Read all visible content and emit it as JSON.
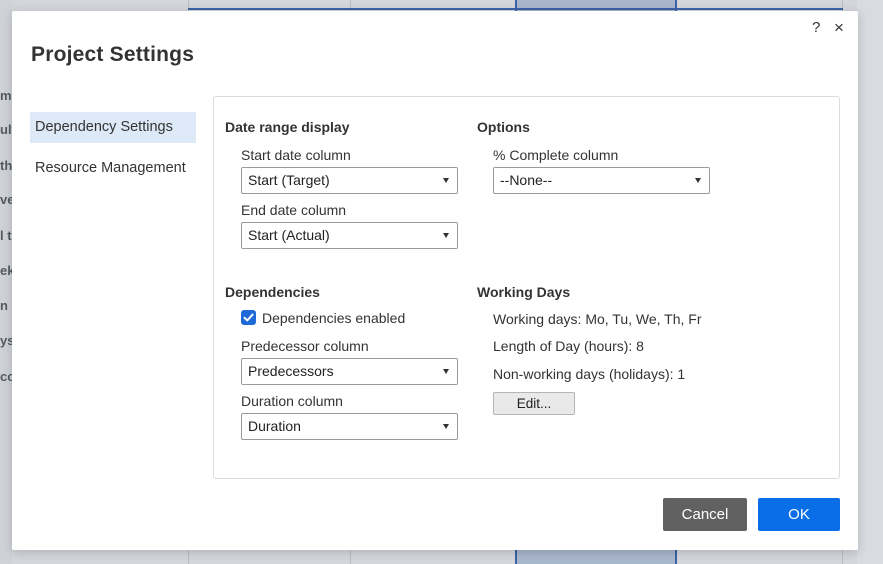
{
  "background": {
    "left_fragments": [
      {
        "text": "m",
        "bold": true
      },
      {
        "text": "ult",
        "bold": true
      },
      {
        "text": "th",
        "bold": true
      },
      {
        "text": "ve",
        "bold": true
      },
      {
        "text": "l t",
        "bold": true
      },
      {
        "text": "ek",
        "bold": true
      },
      {
        "text": "n",
        "bold": true
      },
      {
        "text": "ys",
        "bold": true
      },
      {
        "text": "co",
        "bold": true
      }
    ]
  },
  "dialog": {
    "title": "Project Settings",
    "help_label": "?",
    "close_label": "×"
  },
  "nav": {
    "items": [
      {
        "label": "Dependency Settings",
        "active": true
      },
      {
        "label": "Resource Management",
        "active": false
      }
    ]
  },
  "date_range": {
    "title": "Date range display",
    "start_label": "Start date column",
    "start_value": "Start (Target)",
    "end_label": "End date column",
    "end_value": "Start (Actual)"
  },
  "options": {
    "title": "Options",
    "complete_label": "% Complete column",
    "complete_value": "--None--"
  },
  "dependencies": {
    "title": "Dependencies",
    "enabled_label": "Dependencies enabled",
    "enabled": true,
    "predecessor_label": "Predecessor column",
    "predecessor_value": "Predecessors",
    "duration_label": "Duration column",
    "duration_value": "Duration"
  },
  "working_days": {
    "title": "Working Days",
    "days_line": "Working days: Mo, Tu, We, Th, Fr",
    "length_line": "Length of Day (hours): 8",
    "holidays_line": "Non-working days (holidays): 1",
    "edit_label": "Edit..."
  },
  "footer": {
    "cancel_label": "Cancel",
    "ok_label": "OK"
  },
  "colors": {
    "primary": "#0a6ee8",
    "cancel": "#616161",
    "nav_active": "#dde9f7",
    "checkbox": "#1f6ad8"
  }
}
